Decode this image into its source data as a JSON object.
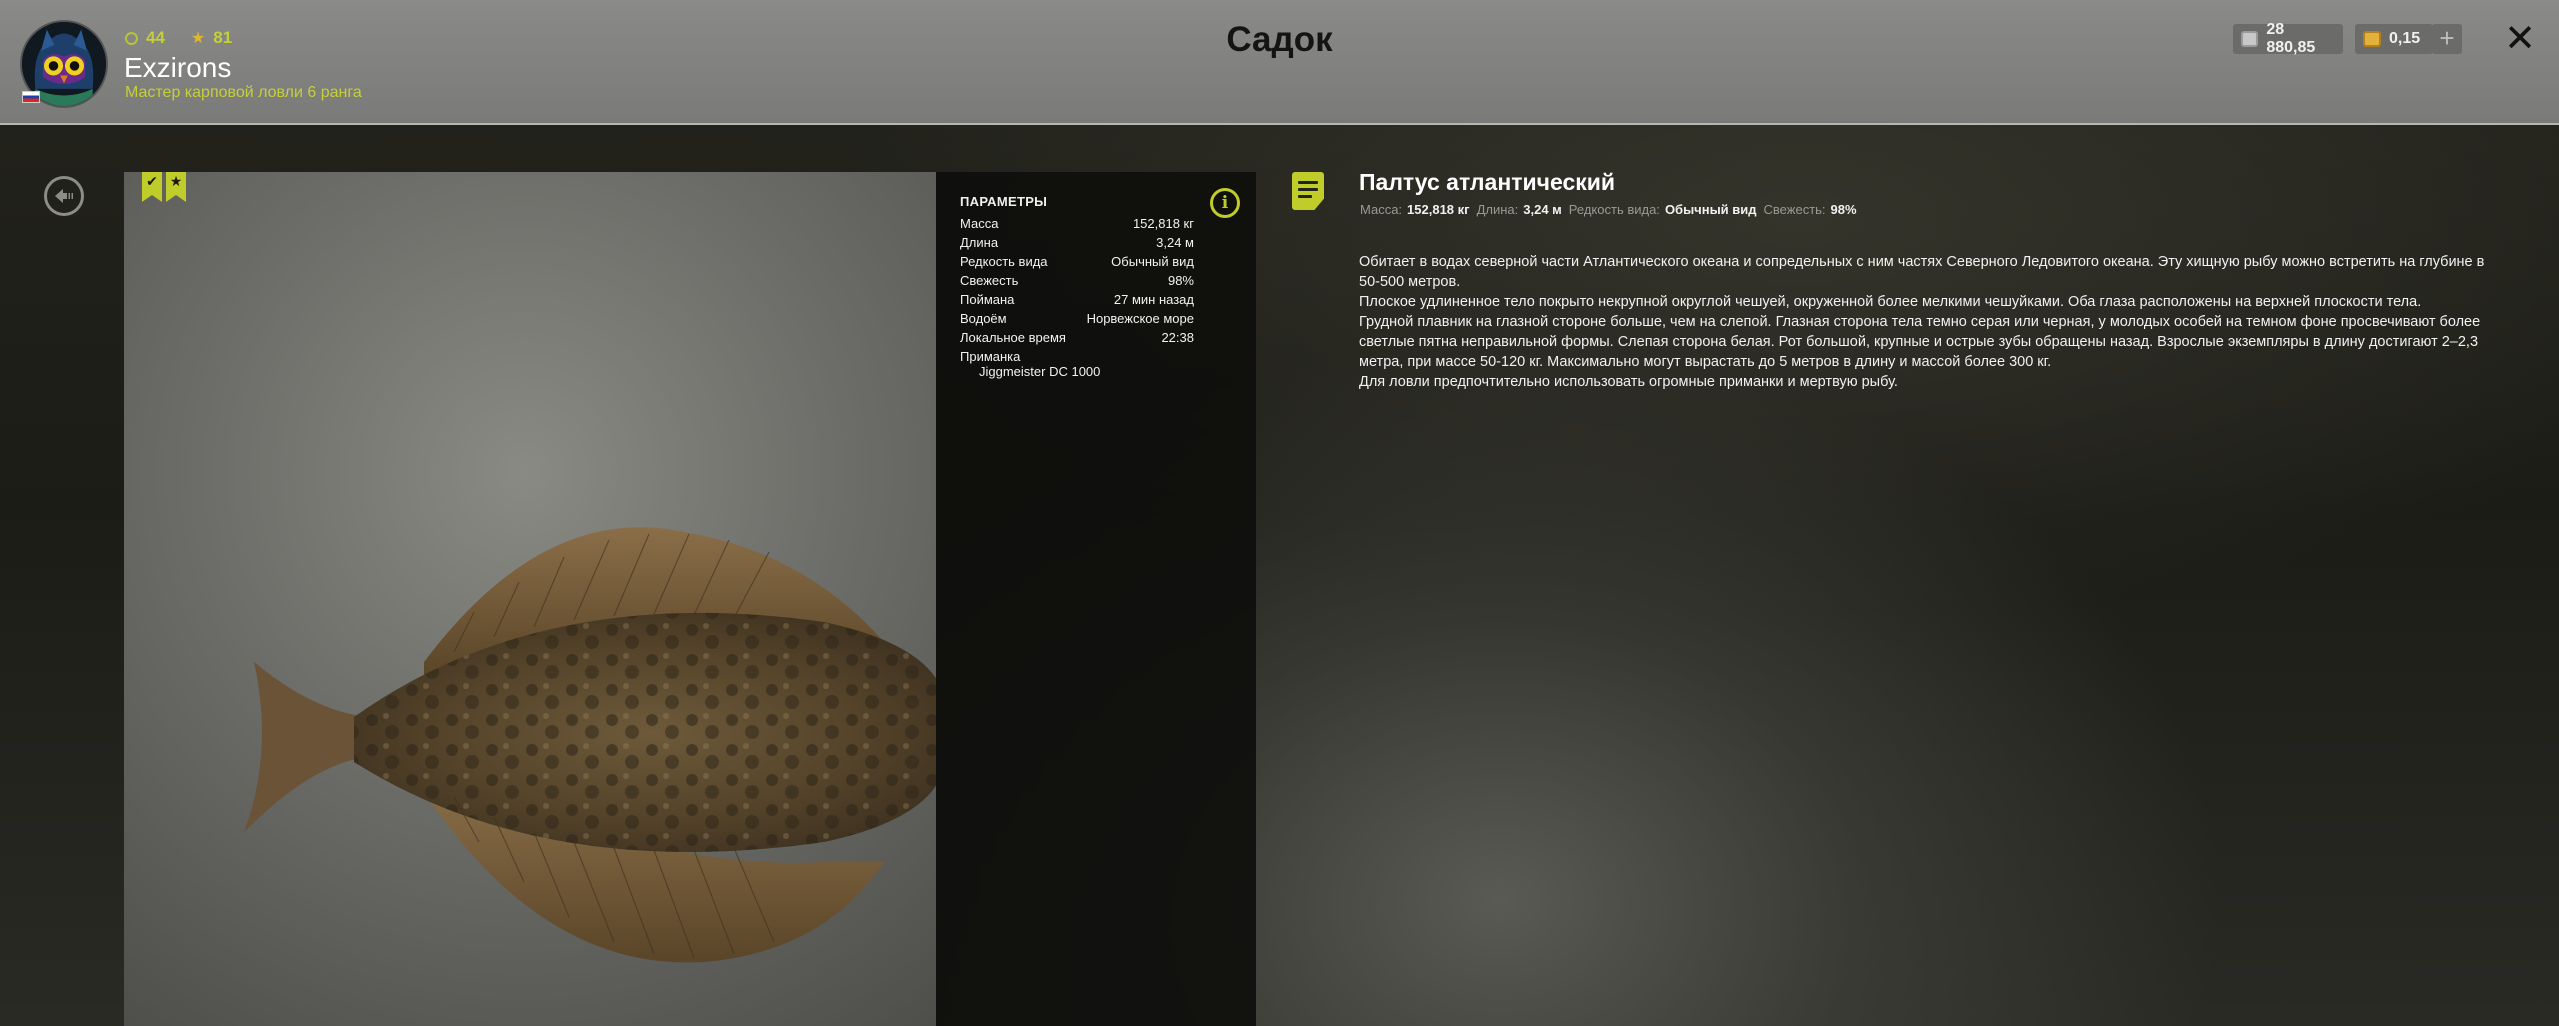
{
  "header": {
    "level": "44",
    "stars": "81",
    "username": "Exzirons",
    "rank": "Мастер карповой ловли 6 ранга",
    "title": "Садок",
    "silver": "28 880,85",
    "gold": "0,15",
    "plus_label": "+",
    "close_label": "✕"
  },
  "icons": {
    "avatar": "owl-avatar",
    "flag": "russia-flag-icon",
    "level": "ring-icon",
    "stars": "star-icon",
    "silver": "silver-coin-icon",
    "gold": "gold-coin-icon",
    "back": "back-icon",
    "info": "info-icon",
    "note": "note-icon",
    "marks": [
      "check-bookmark-icon",
      "star-bookmark-icon"
    ]
  },
  "marks": {
    "check": "✔",
    "star": "★"
  },
  "params": {
    "title": "ПАРАМЕТРЫ",
    "info_label": "i",
    "rows": [
      {
        "label": "Масса",
        "value": "152,818 кг"
      },
      {
        "label": "Длина",
        "value": "3,24 м"
      },
      {
        "label": "Редкость вида",
        "value": "Обычный вид"
      },
      {
        "label": "Свежесть",
        "value": "98%"
      },
      {
        "label": "Поймана",
        "value": "27 мин назад"
      },
      {
        "label": "Водоём",
        "value": "Норвежское море"
      },
      {
        "label": "Локальное время",
        "value": "22:38"
      }
    ],
    "bait_label": "Приманка",
    "bait_value": "Jiggmeister DC 1000"
  },
  "fish": {
    "name": "Палтус атлантический",
    "summary": [
      {
        "label": "Масса:",
        "value": "152,818 кг"
      },
      {
        "label": "Длина:",
        "value": "3,24 м"
      },
      {
        "label": "Редкость вида:",
        "value": "Обычный вид"
      },
      {
        "label": "Свежесть:",
        "value": "98%"
      }
    ],
    "description": [
      "Обитает в водах северной части Атлантического океана и сопредельных с ним частях Северного Ледовитого океана. Эту хищную рыбу можно встретить на глубине в 50-500 метров.",
      "Плоское удлиненное тело покрыто некрупной округлой чешуей, окруженной более мелкими чешуйками. Оба глаза расположены на верхней плоскости тела.",
      "Грудной плавник на глазной стороне больше, чем на слепой. Глазная сторона тела темно серая или черная, у молодых особей на темном фоне просвечивают более светлые пятна неправильной формы. Слепая сторона белая. Рот большой, крупные и острые зубы обращены назад. Взрослые экземпляры в длину достигают 2–2,3 метра, при массе 50-120 кг. Максимально могут вырастать до 5 метров в длину и массой более 300 кг.",
      "Для ловли предпочтительно использовать огромные приманки и мертвую рыбу."
    ]
  },
  "colors": {
    "accent": "#c0cc2a",
    "header_bg": "#888886",
    "panel_bg": "#0e0e0c"
  }
}
